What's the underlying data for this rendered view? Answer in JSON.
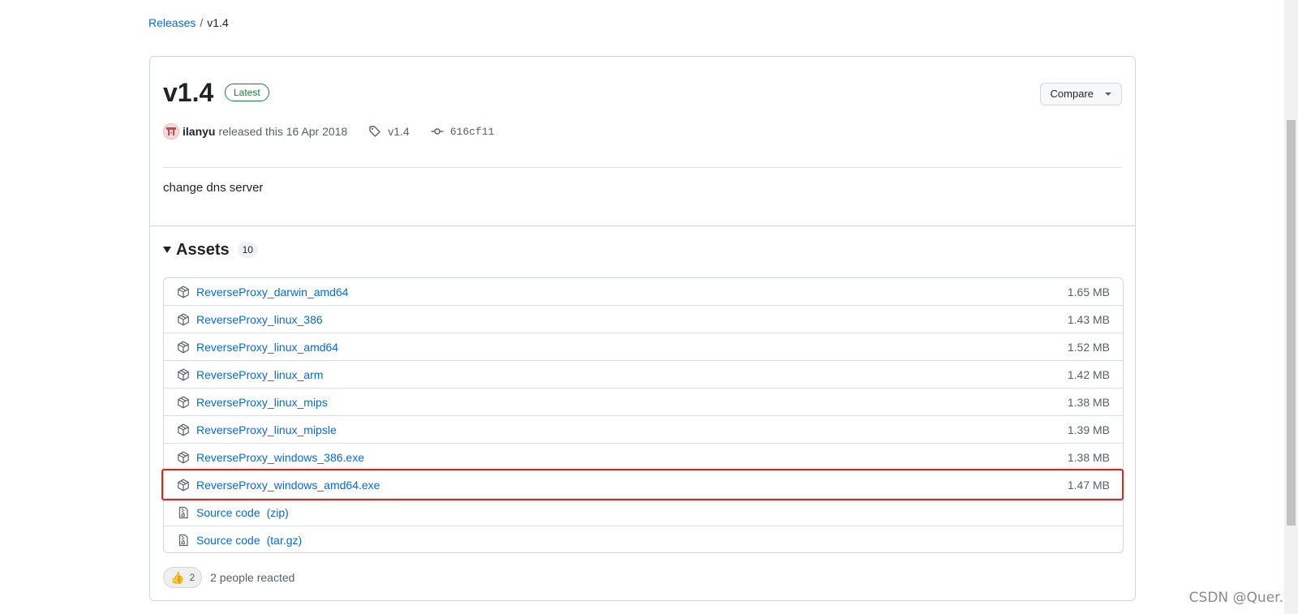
{
  "breadcrumb": {
    "root": "Releases",
    "separator": "/",
    "current": "v1.4"
  },
  "release": {
    "title": "v1.4",
    "badge": "Latest",
    "compare_label": "Compare",
    "author": "ilanyu",
    "released_text": "released this 16 Apr 2018",
    "tag": "v1.4",
    "commit": "616cf11",
    "notes": "change dns server"
  },
  "assets": {
    "title": "Assets",
    "count": "10",
    "items": [
      {
        "name": "ReverseProxy_darwin_amd64",
        "size": "1.65 MB"
      },
      {
        "name": "ReverseProxy_linux_386",
        "size": "1.43 MB"
      },
      {
        "name": "ReverseProxy_linux_amd64",
        "size": "1.52 MB"
      },
      {
        "name": "ReverseProxy_linux_arm",
        "size": "1.42 MB"
      },
      {
        "name": "ReverseProxy_linux_mips",
        "size": "1.38 MB"
      },
      {
        "name": "ReverseProxy_linux_mipsle",
        "size": "1.39 MB"
      },
      {
        "name": "ReverseProxy_windows_386.exe",
        "size": "1.38 MB"
      },
      {
        "name": "ReverseProxy_windows_amd64.exe",
        "size": "1.47 MB"
      }
    ],
    "source": [
      {
        "name": "Source code",
        "format": "(zip)"
      },
      {
        "name": "Source code",
        "format": "(tar.gz)"
      }
    ]
  },
  "reactions": {
    "emoji": "👍",
    "count": "2",
    "text": "2 people reacted"
  },
  "watermark": "CSDN @Quer.",
  "colors": {
    "link": "#0969da",
    "latest": "#1a7f37",
    "highlight": "#e2231a"
  }
}
